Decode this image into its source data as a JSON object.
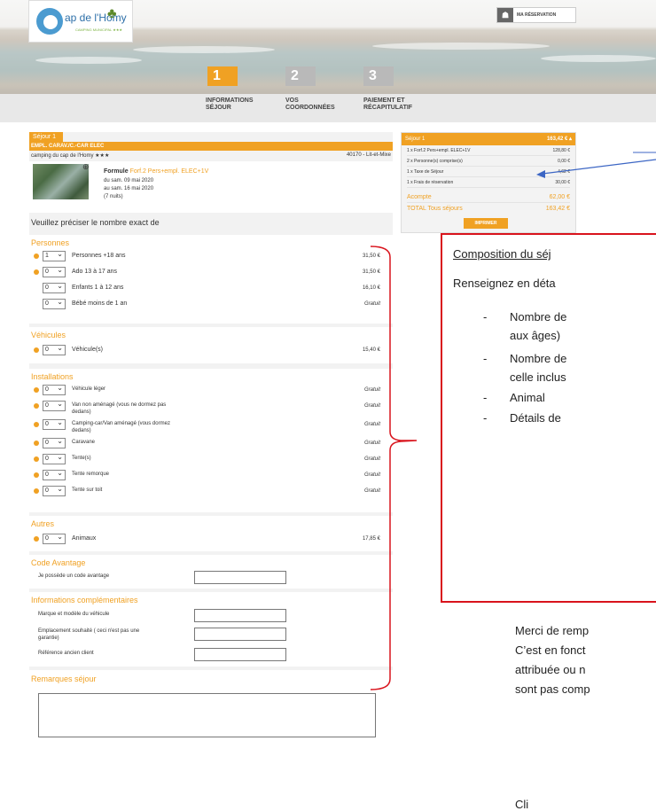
{
  "header": {
    "logo_text": "ap de l'Homy",
    "logo_sub": "CAMPING MUNICIPAL ★★★",
    "reservation_label": "MA RÉSERVATION"
  },
  "steps": [
    {
      "num": "1",
      "label_line1": "INFORMATIONS",
      "label_line2": "SÉJOUR",
      "active": true
    },
    {
      "num": "2",
      "label_line1": "VOS",
      "label_line2": "COORDONNÉES",
      "active": false
    },
    {
      "num": "3",
      "label_line1": "PAIEMENT ET",
      "label_line2": "RÉCAPITULATIF",
      "active": false
    }
  ],
  "sejour": {
    "tab": "Séjour 1",
    "title": "EMPL. CARAV./C.-CAR ELEC",
    "camping": "camping du cap de l'Homy ★★★",
    "location": "40170 - Lit-et-Mixe",
    "formule_label": "Formule",
    "formule_value": "Forf.2 Pers+empl. ELEC+1V",
    "date_from": "du sam. 09 mai 2020",
    "date_to": "au sam. 16 mai 2020",
    "nights": "(7 nuits)",
    "intro": "Veuillez préciser le nombre exact de"
  },
  "personnes": {
    "title": "Personnes",
    "rows": [
      {
        "qty": "1",
        "label": "Personnes +18 ans",
        "price": "31,50 €",
        "dot": true
      },
      {
        "qty": "0",
        "label": "Ado 13 à 17 ans",
        "price": "31,50 €",
        "dot": true
      },
      {
        "qty": "0",
        "label": "Enfants 1 à 12 ans",
        "price": "16,10 €",
        "dot": false
      },
      {
        "qty": "0",
        "label": "Bébé moins de 1 an",
        "price": "Gratuit",
        "dot": false
      }
    ]
  },
  "vehicules": {
    "title": "Véhicules",
    "rows": [
      {
        "qty": "0",
        "label": "Véhicule(s)",
        "price": "15,40 €"
      }
    ]
  },
  "installations": {
    "title": "Installations",
    "rows": [
      {
        "qty": "0",
        "label": "Véhicule léger",
        "label2": "",
        "price": "Gratuit"
      },
      {
        "qty": "0",
        "label": "Van non aménagé (vous ne dormez pas",
        "label2": "dedans)",
        "price": "Gratuit"
      },
      {
        "qty": "0",
        "label": "Camping-car/Van aménagé (vous dormez",
        "label2": "dedans)",
        "price": "Gratuit"
      },
      {
        "qty": "0",
        "label": "Caravane",
        "label2": "",
        "price": "Gratuit"
      },
      {
        "qty": "0",
        "label": "Tente(s)",
        "label2": "",
        "price": "Gratuit"
      },
      {
        "qty": "0",
        "label": "Tente remorque",
        "label2": "",
        "price": "Gratuit"
      },
      {
        "qty": "0",
        "label": "Tente sur toit",
        "label2": "",
        "price": "Gratuit"
      }
    ]
  },
  "autres": {
    "title": "Autres",
    "rows": [
      {
        "qty": "0",
        "label": "Animaux",
        "price": "17,85 €"
      }
    ]
  },
  "code": {
    "title": "Code Avantage",
    "label": "Je possède un code avantage"
  },
  "infos": {
    "title": "Informations complémentaires",
    "marque": "Marque et modèle du véhicule",
    "emplacement_line1": "Emplacement souhaité ( ceci n'est pas une",
    "emplacement_line2": "garantie)",
    "reference": "Référence ancien client"
  },
  "remarques": {
    "title": "Remarques séjour"
  },
  "summary": {
    "title": "Séjour 1",
    "total_head": "163,42 €",
    "rows": [
      {
        "label": "1 x Forf.2 Pers+empl. ELEC+1V",
        "value": "128,80 €"
      },
      {
        "label": "2 x Personne(s) comprise(s)",
        "value": "0,00 €"
      },
      {
        "label": "1 x Taxe de Séjour",
        "value": "4,62 €"
      },
      {
        "label": "1 x Frais de réservation",
        "value": "30,00 €"
      }
    ],
    "acompte_label": "Acompte",
    "acompte_value": "62,00 €",
    "total_label": "TOTAL Tous séjours",
    "total_value": "163,42 €",
    "print_label": "IMPRIMER"
  },
  "annotation": {
    "title": "Composition du séj",
    "intro": "Renseignez en déta",
    "bullets": [
      {
        "dash": "-",
        "line1": "Nombre de",
        "line2": "aux âges)"
      },
      {
        "dash": "-",
        "line1": "Nombre de",
        "line2": "celle inclus"
      },
      {
        "dash": "-",
        "line1": "Animal",
        "line2": ""
      },
      {
        "dash": "-",
        "line1": "Détails de",
        "line2": ""
      }
    ]
  },
  "body_text": {
    "l1": "Merci de remp",
    "l2": "C’est en fonct",
    "l3": "attribuée ou n",
    "l4": "sont pas comp",
    "l5": "Cli"
  },
  "colors": {
    "accent": "#f0a123",
    "red": "#d9131c",
    "arrow": "#3c66c4"
  }
}
